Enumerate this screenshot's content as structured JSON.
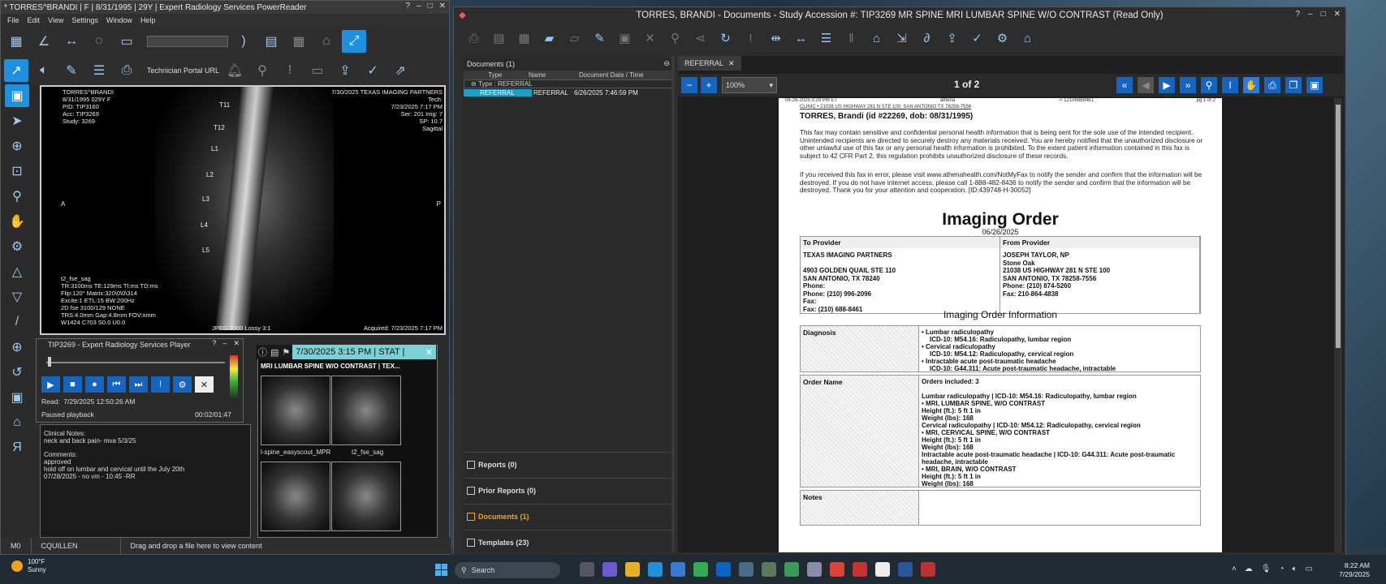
{
  "power_reader": {
    "title": "* TORRES^BRANDI | F | 8/31/1995 | 29Y | Expert Radiology Services PowerReader",
    "menu": [
      "File",
      "Edit",
      "View",
      "Settings",
      "Window",
      "Help"
    ],
    "technician_link": "Technician Portal URL",
    "viewport": {
      "top_left": "TORRES^BRANDI\n8/31/1995 029Y F\nPID: TIP3160\nAcc: TIP3269\nStudy: 3269",
      "top_right": "7/30/2025 TEXAS IMAGING PARTNERS\nTech:\n7/23/2025 7:17 PM\nSer: 201 Img: 7\nSP: 10.7\nSagittal",
      "bottom_left": "t2_fse_sag\nTR:3100ms TE:129ms TI:ms TD:ms\nFlip:120° Matrix:320\\0\\0\\314\nExcite:1 ETL:15 BW:200Hz\n2D fse 3100/129 NONE\nTRS:4.0mm Gap:4.8mm FOV:xmm\nW1424 C703 S0.0 U0.0",
      "bottom_center": "JPEG 2000 Lossy 3:1",
      "bottom_right": "Acquired: 7/23/2025 7:17 PM",
      "side_left": "A",
      "side_right": "P",
      "vertebra_labels": [
        "T11",
        "T12",
        "L1",
        "L2",
        "L3",
        "L4",
        "L5"
      ]
    },
    "player": {
      "title": "TIP3269 - Expert Radiology Services Player",
      "read_label": "Read:",
      "read_value": "7/29/2025 12:50:26 AM",
      "status": "Paused playback",
      "time": "00:02/01:47"
    },
    "notes": {
      "clinical_label": "Clinical Notes:",
      "clinical": "neck and back pain- mva 5/3/25",
      "comments_label": "Comments:",
      "comments": "approved\nhold off on lumbar and cervical until the July 20th\n07/28/2025 - no vm - 10:45 -RR"
    },
    "thumbs": {
      "header": "7/30/2025 3:15 PM | STAT |",
      "title": "MRI LUMBAR SPINE W/O CONTRAST | TEX...",
      "labels": [
        "l-spine_easyscout_MPR",
        "t2_fse_sag"
      ]
    },
    "statusbar": {
      "m": "M0",
      "user": "CQUILLEN",
      "drop": "Drag and drop a file here to view content"
    }
  },
  "documents_window": {
    "title": "TORRES, BRANDI - Documents - Study Accession #: TIP3269 MR SPINE MRI LUMBAR SPINE W/O CONTRAST (Read Only)",
    "panel_header": "Documents (1)",
    "columns": [
      "Type",
      "Name",
      "Document Date / Time"
    ],
    "type_group": "Type : REFERRAL",
    "row": {
      "type": "REFERRAL",
      "name": "REFERRAL",
      "date": "6/26/2025 7:46:59 PM"
    },
    "sections": [
      "Reports (0)",
      "Prior Reports (0)",
      "Documents (1)",
      "Templates (23)"
    ],
    "active_section_color": "#f0a030",
    "tab": "REFERRAL",
    "zoom": "100%",
    "page_indicator": "1 of 2"
  },
  "fax": {
    "header_left": "06-26-2025 3:29 PM ET",
    "header_mid": "athena",
    "header_num": "-> 12106888461",
    "header_right": "pg 1 of 2",
    "clinic": "CLINIC • 21038 US HIGHWAY 281 N STE 100, SAN ANTONIO TX 78258-7556",
    "patient": "TORRES, Brandi (id #22269, dob: 08/31/1995)",
    "disclaimer1": "This fax may contain sensitive and confidential personal health information that is being sent for the sole use of the intended recipient. Unintended recipients are directed to securely destroy any materials received. You are hereby notified that the unauthorized disclosure or other unlawful use of this fax or any personal health information is prohibited. To the extent patient information contained in this fax is subject to 42 CFR Part 2, this regulation prohibits unauthorized disclosure of these records.",
    "disclaimer2": "If you received this fax in error, please visit www.athenahealth.com/NotMyFax to notify the sender and confirm that the information will be destroyed. If you do not have internet access, please call 1-888-482-8436 to notify the sender and confirm that the information will be destroyed. Thank you for your attention and cooperation. [ID:439748-H-30052]",
    "title": "Imaging Order",
    "date": "06/26/2025",
    "to_label": "To Provider",
    "from_label": "From Provider",
    "to": "TEXAS IMAGING PARTNERS\n\n4903 GOLDEN QUAIL STE 110\nSAN ANTONIO, TX 78240\nPhone:\nPhone: (210) 996-2096\nFax:\nFax: (210) 688-8461",
    "from": "JOSEPH TAYLOR, NP\nStone Oak\n21038 US HIGHWAY 281 N STE 100\nSAN ANTONIO, TX 78258-7556\nPhone: (210) 874-5260\nFax: 210-864-4838",
    "info_title": "Imaging Order Information",
    "diagnosis_label": "Diagnosis",
    "diagnosis": [
      "• Lumbar radiculopathy",
      "ICD-10: M54.16: Radiculopathy, lumbar region",
      "• Cervical radiculopathy",
      "ICD-10: M54.12: Radiculopathy, cervical region",
      "• Intractable acute post-traumatic headache",
      "ICD-10: G44.311: Acute post-traumatic headache, intractable"
    ],
    "order_label": "Order Name",
    "order": [
      "Orders included: 3",
      "",
      "Lumbar radiculopathy | ICD-10: M54.16: Radiculopathy, lumbar region",
      "• MRI, LUMBAR SPINE, W/O CONTRAST",
      "Height (ft.): 5 ft 1 in",
      "Weight (lbs): 168",
      "Cervical radiculopathy | ICD-10: M54.12: Radiculopathy, cervical region",
      "• MRI, CERVICAL SPINE, W/O CONTRAST",
      "Height (ft.): 5 ft 1 in",
      "Weight (lbs): 168",
      "Intractable acute post-traumatic headache | ICD-10: G44.311: Acute post-traumatic headache, intractable",
      "• MRI, BRAIN, W/O CONTRAST",
      "Height (ft.): 5 ft 1 in",
      "Weight (lbs): 168"
    ],
    "notes_label": "Notes"
  },
  "taskbar": {
    "temp": "100°F",
    "weather": "Sunny",
    "search": "Search",
    "time": "8:22 AM",
    "date": "7/29/2025"
  }
}
